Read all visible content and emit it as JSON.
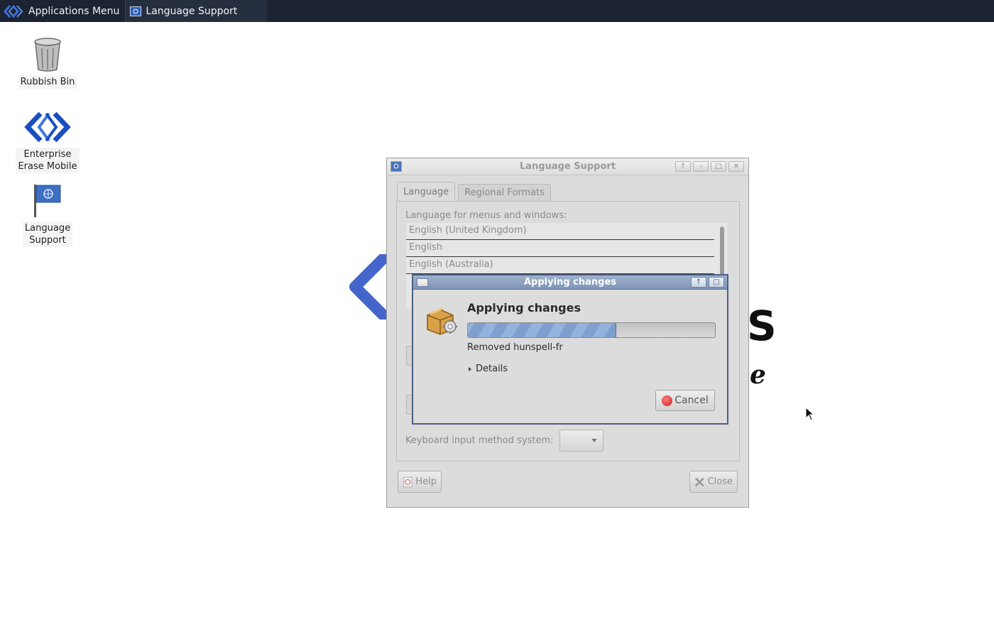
{
  "panel": {
    "apps_menu_label": "Applications Menu",
    "taskbar_item_label": "Language Support"
  },
  "desktop": {
    "icons": [
      {
        "label": "Rubbish Bin"
      },
      {
        "label": "Enterprise\nErase Mobile"
      },
      {
        "label": "Language\nSupport"
      }
    ]
  },
  "main_window": {
    "title": "Language Support",
    "tabs": [
      {
        "label": "Language",
        "active": true
      },
      {
        "label": "Regional Formats",
        "active": false
      }
    ],
    "language_label": "Language for menus and windows:",
    "languages": [
      "English (United Kingdom)",
      "English",
      "English (Australia)"
    ],
    "keyboard_label": "Keyboard input method system:",
    "keyboard_value": "",
    "help_label": "Help",
    "close_label": "Close"
  },
  "dialog": {
    "title": "Applying changes",
    "heading": "Applying changes",
    "progress_percent": 60,
    "status_text": "Removed hunspell-fr",
    "details_label": "Details",
    "cancel_label": "Cancel"
  },
  "colors": {
    "panel_bg": "#1c2433",
    "dialog_title_bg": "#8fa3c3",
    "progress_fill": "#7fa0cf"
  }
}
